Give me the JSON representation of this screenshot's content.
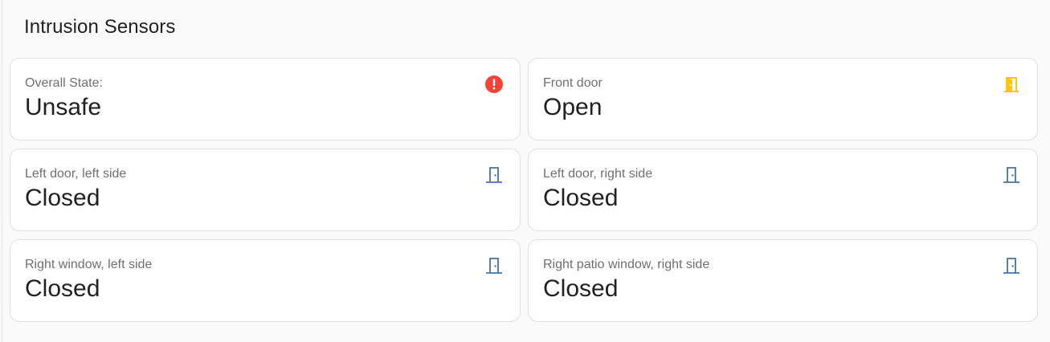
{
  "section": {
    "title": "Intrusion Sensors"
  },
  "colors": {
    "alert": "#f44336",
    "open": "#fdc60f",
    "closed": "#44739e"
  },
  "tiles": [
    {
      "name": "Overall State:",
      "state": "Unsafe",
      "icon": "alert-circle-icon"
    },
    {
      "name": "Front door",
      "state": "Open",
      "icon": "door-open-icon"
    },
    {
      "name": "Left door, left side",
      "state": "Closed",
      "icon": "door-closed-icon"
    },
    {
      "name": "Left door, right side",
      "state": "Closed",
      "icon": "door-closed-icon"
    },
    {
      "name": "Right window, left side",
      "state": "Closed",
      "icon": "door-closed-icon"
    },
    {
      "name": "Right patio window, right side",
      "state": "Closed",
      "icon": "door-closed-icon"
    }
  ]
}
